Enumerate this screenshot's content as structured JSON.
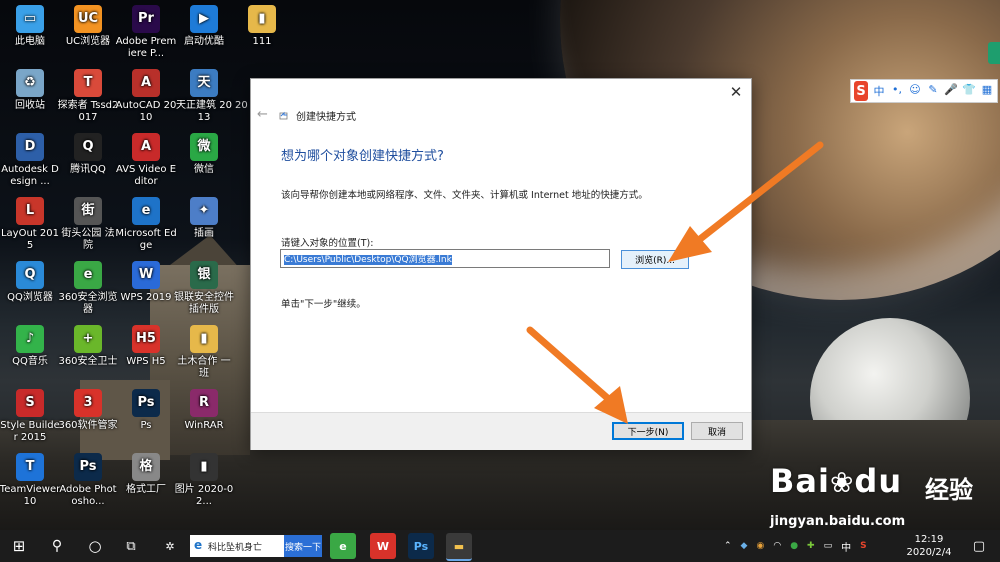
{
  "desktop_icons": [
    {
      "label": "此电脑",
      "glyph": "▭",
      "color": "#3aa0e8"
    },
    {
      "label": "UC浏览器",
      "glyph": "UC",
      "color": "#f39322"
    },
    {
      "label": "Adobe Premiere P...",
      "glyph": "Pr",
      "color": "#2a0a4a"
    },
    {
      "label": "启动优酷",
      "glyph": "▶",
      "color": "#1e7bd8"
    },
    {
      "label": "111",
      "glyph": "▮",
      "color": "#e6b84a"
    },
    {
      "label": "回收站",
      "glyph": "♻",
      "color": "#7aa6c8"
    },
    {
      "label": "探索者 Tssd2017",
      "glyph": "T",
      "color": "#d94a3a"
    },
    {
      "label": "AutoCAD 2010",
      "glyph": "A",
      "color": "#b8302a"
    },
    {
      "label": "天正建筑 2013",
      "glyph": "天",
      "color": "#3c7cc2"
    },
    {
      "label": "Autodesk Design ...",
      "glyph": "D",
      "color": "#2d5fa8"
    },
    {
      "label": "腾讯QQ",
      "glyph": "Q",
      "color": "#222"
    },
    {
      "label": "AVS Video Editor",
      "glyph": "A",
      "color": "#c82a2a"
    },
    {
      "label": "微信",
      "glyph": "微",
      "color": "#2aa845"
    },
    {
      "label": "LayOut 2015",
      "glyph": "L",
      "color": "#c8362a"
    },
    {
      "label": "街头公园 法院",
      "glyph": "街",
      "color": "#555"
    },
    {
      "label": "Microsoft Edge",
      "glyph": "e",
      "color": "#1e73c8"
    },
    {
      "label": "插画",
      "glyph": "✦",
      "color": "#4d7ec8"
    },
    {
      "label": "QQ浏览器",
      "glyph": "Q",
      "color": "#2a8ad8"
    },
    {
      "label": "360安全浏览器",
      "glyph": "e",
      "color": "#3aa845"
    },
    {
      "label": "WPS 2019",
      "glyph": "W",
      "color": "#2a6ad8"
    },
    {
      "label": "银联安全控件插件版",
      "glyph": "银",
      "color": "#2a6a4a"
    },
    {
      "label": "QQ音乐",
      "glyph": "♪",
      "color": "#33b34a"
    },
    {
      "label": "360安全卫士",
      "glyph": "+",
      "color": "#6ab72a"
    },
    {
      "label": "WPS H5",
      "glyph": "H5",
      "color": "#d8322a"
    },
    {
      "label": "土木合作 一班",
      "glyph": "▮",
      "color": "#e6b84a"
    },
    {
      "label": "Style Builder 2015",
      "glyph": "S",
      "color": "#c82a2a"
    },
    {
      "label": "360软件管家",
      "glyph": "3",
      "color": "#d8322a"
    },
    {
      "label": "Ps",
      "glyph": "Ps",
      "color": "#0c2a4a"
    },
    {
      "label": "WinRAR",
      "glyph": "R",
      "color": "#8a2a6a"
    },
    {
      "label": "TeamViewer 10",
      "glyph": "T",
      "color": "#1e73d8"
    },
    {
      "label": "Adobe Photosho...",
      "glyph": "Ps",
      "color": "#0c2a4a"
    },
    {
      "label": "格式工厂",
      "glyph": "格",
      "color": "#888"
    },
    {
      "label": "图片 2020-02...",
      "glyph": "▮",
      "color": "#333"
    }
  ],
  "wallpaper_text": "20",
  "dialog": {
    "window_title": "创建快捷方式",
    "heading": "想为哪个对象创建快捷方式?",
    "description": "该向导帮你创建本地或网络程序、文件、文件夹、计算机或 Internet 地址的快捷方式。",
    "location_label": "请键入对象的位置(T):",
    "location_value": "C:\\Users\\Public\\Desktop\\QQ浏览器.lnk",
    "browse_label": "浏览(R)...",
    "hint": "单击\"下一步\"继续。",
    "next_label": "下一步(N)",
    "cancel_label": "取消",
    "close_glyph": "✕",
    "back_glyph": "←"
  },
  "ime_toolbar": {
    "logo": "S",
    "items": [
      "中",
      "•,",
      "☺",
      "✎",
      "🎤",
      "👕",
      "▦"
    ]
  },
  "watermark": {
    "main": "Bai",
    "paw": "❀",
    "du": "du",
    "cn": "经验",
    "url": "jingyan.baidu.com"
  },
  "taskbar": {
    "start_glyph": "⊞",
    "search_glyph": "⚲",
    "cortana_glyph": "○",
    "taskview_glyph": "⧉",
    "search_box_text": "科比坠机身亡",
    "search_button": "搜索一下",
    "apps": [
      {
        "name": "pinwheel",
        "glyph": "✲",
        "color": "#1c1c1c",
        "text_color": "#fff"
      },
      {
        "name": "360",
        "glyph": "e",
        "color": "#3aa845",
        "text_color": "#fff"
      },
      {
        "name": "wps",
        "glyph": "W",
        "color": "#d8322a",
        "text_color": "#fff"
      },
      {
        "name": "photoshop",
        "glyph": "Ps",
        "color": "#0c2a4a",
        "text_color": "#5ab4ff"
      },
      {
        "name": "explorer",
        "glyph": "▬",
        "color": "#3a3a3a",
        "text_color": "#f2c14e"
      }
    ],
    "tray_ime": "中",
    "time": "12:19",
    "date": "2020/2/4"
  },
  "colors": {
    "accent": "#0078d7",
    "arrow": "#f07a24",
    "heading": "#1f4e9e"
  }
}
